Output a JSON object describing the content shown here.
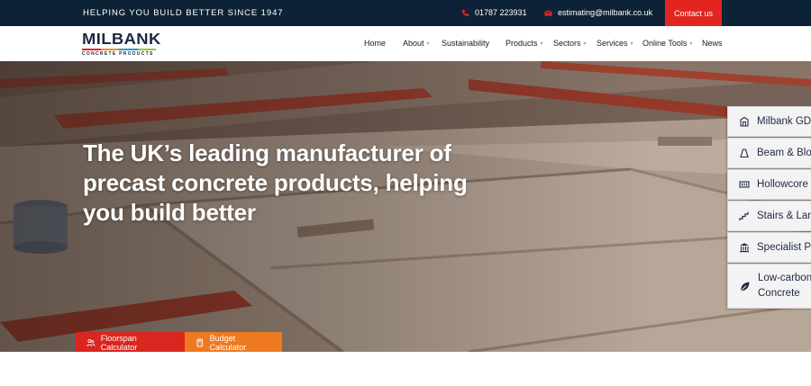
{
  "topbar": {
    "tagline": "HELPING YOU BUILD BETTER SINCE 1947",
    "phone": "01787 223931",
    "email": "estimating@milbank.co.uk",
    "contact_label": "Contact us"
  },
  "logo": {
    "main": "MILBANK",
    "sub": "CONCRETE PRODUCTS",
    "stripe_colors": [
      "#e3251f",
      "#f08a24",
      "#1d9bd7",
      "#8dc63f"
    ]
  },
  "nav": {
    "items": [
      {
        "label": "Home",
        "has_dropdown": false
      },
      {
        "label": "About",
        "has_dropdown": true
      },
      {
        "label": "Sustainability",
        "has_dropdown": false
      },
      {
        "label": "Products",
        "has_dropdown": true
      },
      {
        "label": "Sectors",
        "has_dropdown": true
      },
      {
        "label": "Services",
        "has_dropdown": true
      },
      {
        "label": "Online Tools",
        "has_dropdown": true
      },
      {
        "label": "News",
        "has_dropdown": false
      }
    ]
  },
  "hero": {
    "headline": "The UK’s leading manufacturer of precast concrete products, helping you build better",
    "buttons": {
      "floorspan": "Floorspan Calculator",
      "budget": "Budget Calculator"
    }
  },
  "product_tabs": [
    {
      "label": "Milbank GD",
      "icon": "building-icon"
    },
    {
      "label": "Beam & Blo",
      "icon": "beam-block-icon"
    },
    {
      "label": "Hollowcore",
      "icon": "hollowcore-icon"
    },
    {
      "label": "Stairs & Lan",
      "icon": "stairs-icon"
    },
    {
      "label": "Specialist P",
      "icon": "bank-icon"
    },
    {
      "label": "Low-carbon Concrete",
      "icon": "leaf-icon"
    }
  ],
  "colors": {
    "navy": "#0e2237",
    "red": "#e3251f",
    "orange": "#ee7a20"
  }
}
